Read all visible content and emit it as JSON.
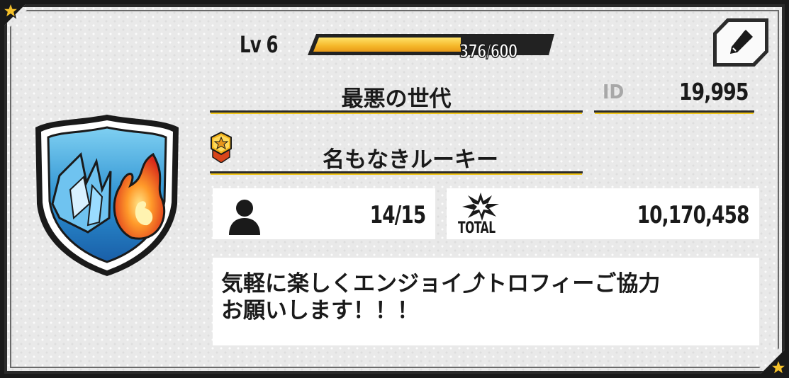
{
  "profile": {
    "level_label": "Lv 6",
    "xp_text": "376/600",
    "xp_progress": 0.627,
    "team_name": "最悪の世代",
    "id_label": "ID",
    "id_value": "19,995",
    "title": "名もなきルーキー",
    "members": "14/15",
    "total_label": "TOTAL",
    "total_value": "10,170,458",
    "comment": "気軽に楽しくエンジョイ⤴トロフィーご協力\nお願いします！！！"
  },
  "icons": {
    "emblem": "team-shield-emblem-icon",
    "edit": "pencil-icon",
    "rank": "gold-star-rank-badge-icon",
    "member": "person-icon",
    "total": "explosion-burst-icon",
    "corner": "star-icon"
  },
  "colors": {
    "xp_fill": "#f5b72a",
    "underline_accent": "#f0c419",
    "frame": "#2b2b2b",
    "panel_bg": "#e9e9e9"
  }
}
